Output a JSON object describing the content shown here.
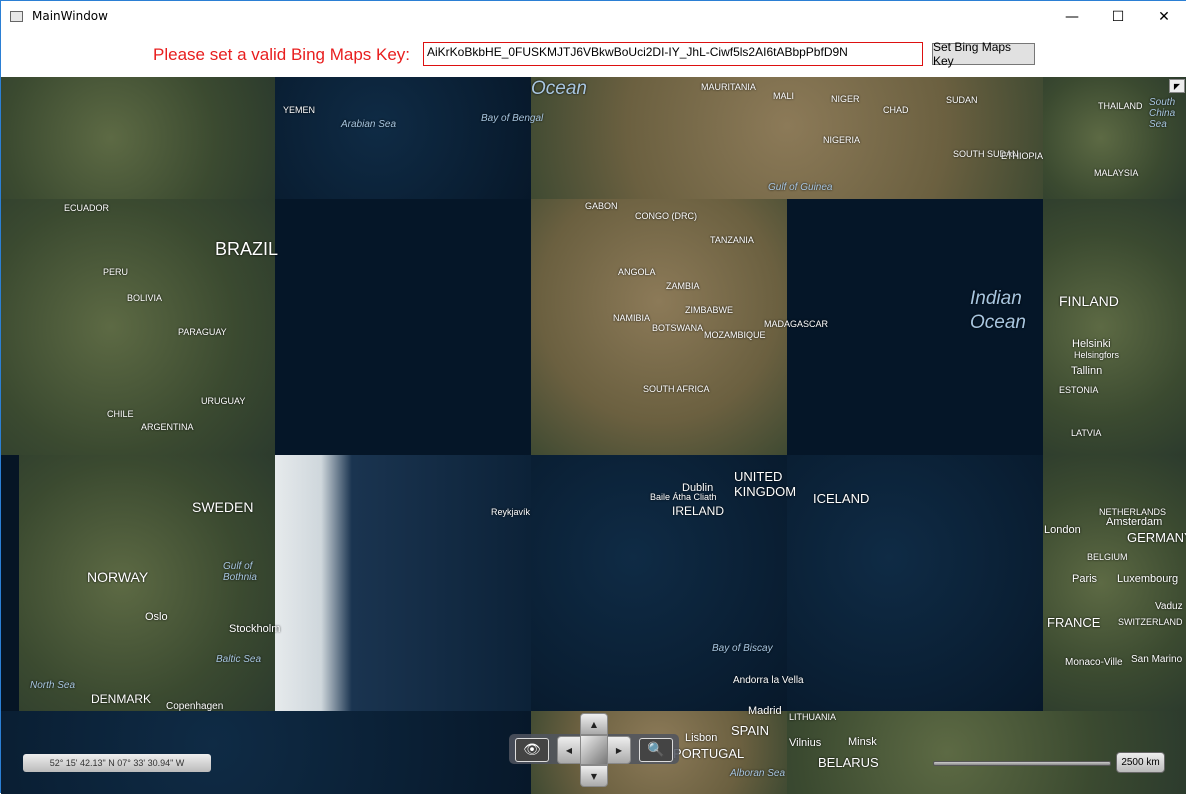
{
  "window": {
    "title": "MainWindow",
    "minimize": "—",
    "maximize": "☐",
    "close": "✕"
  },
  "keybar": {
    "label": "Please set a valid Bing Maps Key:",
    "key_value": "AiKrKoBkbHE_0FUSKMJTJ6VBkwBoUci2DI-IY_JhL-Ciwf5ls2AI6tABbpPbfD9N",
    "button": "Set Bing Maps Key"
  },
  "map": {
    "labels": [
      "Ocean",
      "YEMEN",
      "Arabian Sea",
      "Bay of Bengal",
      "MAURITANIA",
      "MALI",
      "NIGER",
      "CHAD",
      "SUDAN",
      "NIGERIA",
      "SOUTH SUDAN",
      "ETHIOPIA",
      "Gulf of Guinea",
      "THAILAND",
      "MALAYSIA",
      "South China Sea",
      "ECUADOR",
      "BRAZIL",
      "PERU",
      "BOLIVIA",
      "PARAGUAY",
      "CHILE",
      "URUGUAY",
      "ARGENTINA",
      "GABON",
      "CONGO (DRC)",
      "TANZANIA",
      "ANGOLA",
      "ZAMBIA",
      "ZIMBABWE",
      "NAMIBIA",
      "BOTSWANA",
      "MOZAMBIQUE",
      "MADAGASCAR",
      "SOUTH AFRICA",
      "Indian\nOcean",
      "FINLAND",
      "Helsinki",
      "Helsingfors",
      "Tallinn",
      "ESTONIA",
      "LATVIA",
      "SWEDEN",
      "NORWAY",
      "Gulf of Bothnia",
      "Oslo",
      "Stockholm",
      "Baltic Sea",
      "North Sea",
      "DENMARK",
      "Copenhagen",
      "Reykjavík",
      "Dublin",
      "Baile Átha Cliath",
      "IRELAND",
      "UNITED KINGDOM",
      "ICELAND",
      "NETHERLANDS",
      "Amsterdam",
      "London",
      "GERMANY",
      "BELGIUM",
      "Paris",
      "Luxembourg",
      "FRANCE",
      "Vaduz",
      "SWITZERLAND",
      "Monaco-Ville",
      "San Marino",
      "Bay of Biscay",
      "Andorra la Vella",
      "Madrid",
      "SPAIN",
      "Lisbon",
      "PORTUGAL",
      "Alboran Sea",
      "Minsk",
      "BELARUS",
      "Vilnius",
      "LITHUANIA"
    ]
  },
  "coordinates": "52° 15' 42.13\" N 07° 33' 30.94\" W",
  "scale": "2500 km",
  "nav": {
    "up": "▲",
    "down": "▼",
    "left": "◀",
    "right": "▶",
    "eye": "👁",
    "zoom": "🔍"
  }
}
